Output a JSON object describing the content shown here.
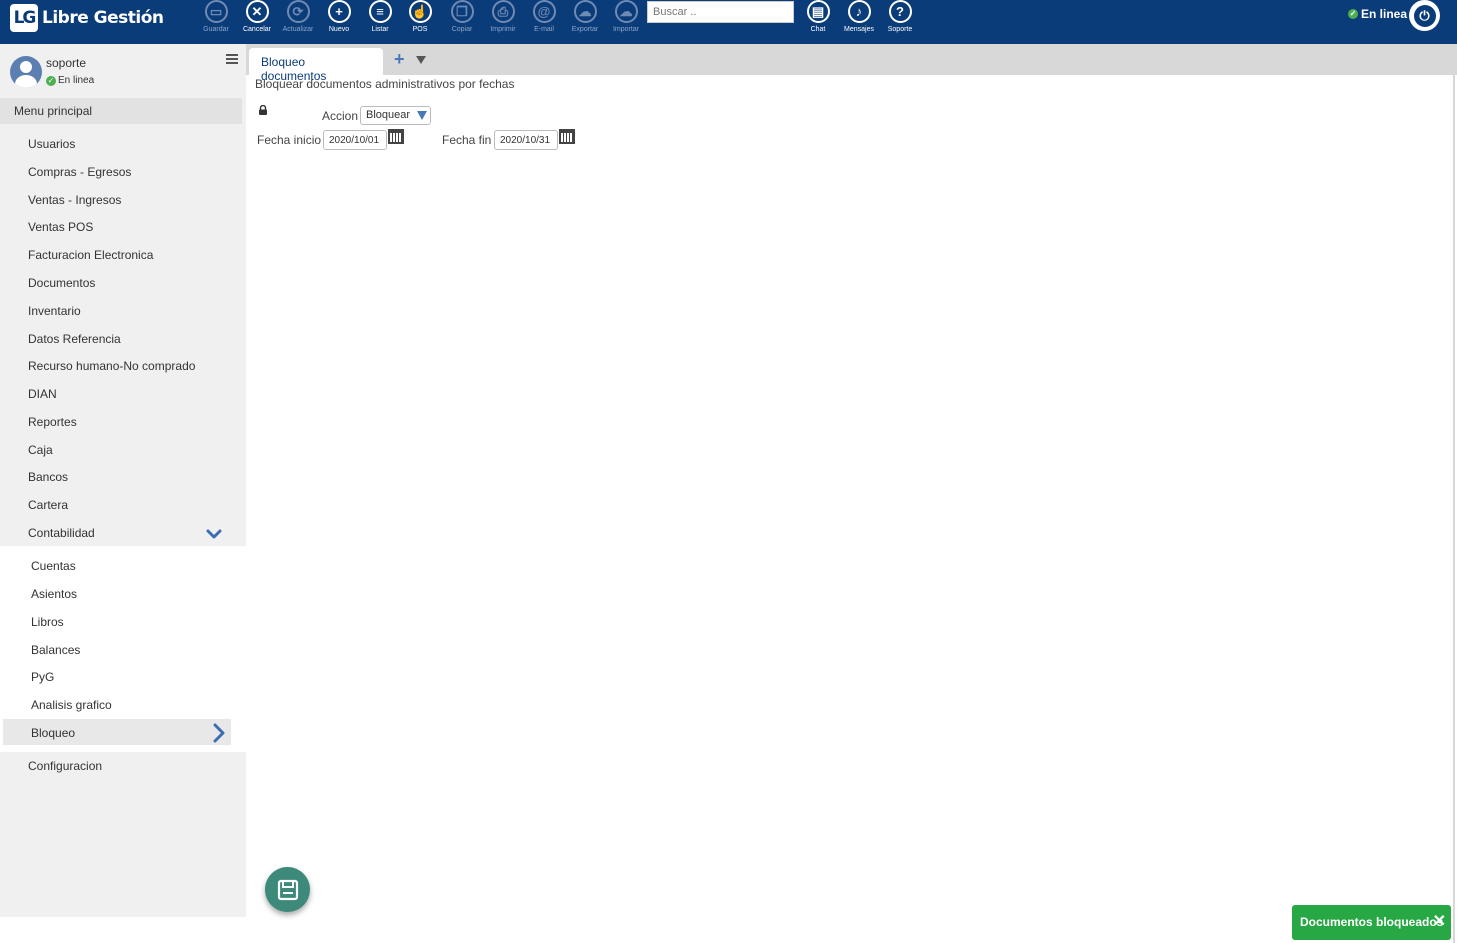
{
  "app": {
    "logo_mark": "LG",
    "logo_name": "Libre Gestión"
  },
  "toolbar": {
    "items": [
      {
        "label": "Guardar",
        "icon": "save-icon",
        "glyph": "▭",
        "enabled": false
      },
      {
        "label": "Cancelar",
        "icon": "close-icon",
        "glyph": "✕",
        "enabled": true
      },
      {
        "label": "Actualizar",
        "icon": "refresh-icon",
        "glyph": "⟳",
        "enabled": false
      },
      {
        "label": "Nuevo",
        "icon": "plus-icon",
        "glyph": "+",
        "enabled": true
      },
      {
        "label": "Listar",
        "icon": "list-icon",
        "glyph": "≡",
        "enabled": true
      },
      {
        "label": "POS",
        "icon": "hand-pointer-icon",
        "glyph": "☝",
        "enabled": true
      },
      {
        "label": "Copiar",
        "icon": "copy-icon",
        "glyph": "❐",
        "enabled": false
      },
      {
        "label": "Imprimir",
        "icon": "print-icon",
        "glyph": "⎙",
        "enabled": false
      },
      {
        "label": "E-mail",
        "icon": "email-icon",
        "glyph": "@",
        "enabled": false
      },
      {
        "label": "Exportar",
        "icon": "cloud-upload-icon",
        "glyph": "☁",
        "enabled": false
      },
      {
        "label": "Importar",
        "icon": "cloud-download-icon",
        "glyph": "☁",
        "enabled": false
      }
    ],
    "search_placeholder": "Buscar ..",
    "right_items": [
      {
        "label": "Chat",
        "icon": "chat-icon",
        "glyph": "▤"
      },
      {
        "label": "Mensajes",
        "icon": "bell-icon",
        "glyph": "♪"
      },
      {
        "label": "Soporte",
        "icon": "help-icon",
        "glyph": "?"
      }
    ],
    "status": "En linea"
  },
  "sidebar": {
    "user_name": "soporte",
    "user_status": "En linea",
    "menu_title": "Menu principal",
    "items": [
      "Usuarios",
      "Compras - Egresos",
      "Ventas - Ingresos",
      "Ventas POS",
      "Facturacion Electronica",
      "Documentos",
      "Inventario",
      "Datos Referencia",
      "Recurso humano-No comprado",
      "DIAN",
      "Reportes",
      "Caja",
      "Bancos",
      "Cartera",
      "Contabilidad"
    ],
    "sub_items": [
      "Cuentas",
      "Asientos",
      "Libros",
      "Balances",
      "PyG",
      "Analisis grafico",
      "Bloqueo"
    ],
    "after_items": [
      "Configuracion"
    ]
  },
  "tabs": {
    "active": "Bloqueo documentos"
  },
  "form": {
    "subtitle": "Bloquear documentos administrativos por fechas",
    "accion_label": "Accion",
    "accion_value": "Bloquear",
    "fecha_inicio_label": "Fecha inicio",
    "fecha_inicio_value": "2020/10/01",
    "fecha_fin_label": "Fecha fin",
    "fecha_fin_value": "2020/10/31"
  },
  "toast": {
    "message": "Documentos bloqueados"
  }
}
